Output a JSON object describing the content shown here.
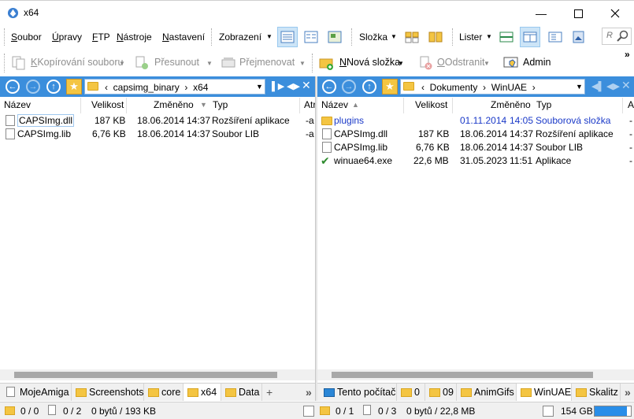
{
  "window": {
    "title": "x64"
  },
  "menu": {
    "items": [
      {
        "label": "Soubor",
        "u": "S",
        "rest": "oubor"
      },
      {
        "label": "Úpravy",
        "u": "Ú",
        "rest": "pravy"
      },
      {
        "label": "FTP",
        "u": "F",
        "rest": "TP"
      },
      {
        "label": "Nástroje",
        "u": "N",
        "rest": "ástroje"
      },
      {
        "label": "Nastavení",
        "u": "N",
        "rest": "astavení"
      }
    ],
    "view_label": "Zobrazení",
    "columns_label": "Sloupce",
    "lister_label": "Lister",
    "sort_label": "Složka",
    "search_hint": "R"
  },
  "commands": {
    "copy": "Kopírování souboru",
    "move": "Přesunout",
    "rename": "Přejmenovat",
    "new_folder": "Nová složka",
    "delete": "Odstranit",
    "admin": "Admin"
  },
  "left_panel": {
    "path": [
      "capsimg_binary",
      "x64"
    ],
    "columns": {
      "name": "Název",
      "size": "Velikost",
      "modified": "Změněno",
      "type": "Typ",
      "attr": "Atr"
    },
    "files": [
      {
        "name": "CAPSImg.dll",
        "size": "187 KB",
        "date": "18.06.2014",
        "time": "14:37",
        "type": "Rozšíření aplikace",
        "attr": "-a",
        "kind": "dll"
      },
      {
        "name": "CAPSImg.lib",
        "size": "6,76 KB",
        "date": "18.06.2014",
        "time": "14:37",
        "type": "Soubor LIB",
        "attr": "-a",
        "kind": "file"
      }
    ],
    "tabs": [
      "MojeAmiga",
      "Screenshots",
      "core",
      "x64",
      "Data"
    ],
    "active_tab": "x64",
    "status": {
      "folders": "0 / 0",
      "files": "0 / 2",
      "bytes": "0 bytů / 193 KB"
    }
  },
  "right_panel": {
    "path": [
      "Dokumenty",
      "WinUAE"
    ],
    "columns": {
      "name": "Název",
      "size": "Velikost",
      "modified": "Změněno",
      "type": "Typ",
      "attr": "A"
    },
    "files": [
      {
        "name": "plugins",
        "size": "",
        "date": "01.11.2014",
        "time": "14:05",
        "type": "Souborová složka",
        "attr": "-",
        "kind": "folder"
      },
      {
        "name": "CAPSImg.dll",
        "size": "187 KB",
        "date": "18.06.2014",
        "time": "14:37",
        "type": "Rozšíření aplikace",
        "attr": "-",
        "kind": "dll"
      },
      {
        "name": "CAPSImg.lib",
        "size": "6,76 KB",
        "date": "18.06.2014",
        "time": "14:37",
        "type": "Soubor LIB",
        "attr": "-",
        "kind": "file"
      },
      {
        "name": "winuae64.exe",
        "size": "22,6 MB",
        "date": "31.05.2023",
        "time": "11:51",
        "type": "Aplikace",
        "attr": "-",
        "kind": "exe"
      }
    ],
    "tabs": [
      "Tento počítač",
      "0",
      "09",
      "AnimGifs",
      "WinUAE",
      "Skalitz"
    ],
    "active_tab": "WinUAE",
    "status": {
      "folders": "0 / 1",
      "files": "0 / 3",
      "bytes": "0 bytů / 22,8 MB",
      "free": "154 GB"
    },
    "disk_used_fraction": 0.9
  },
  "colors": {
    "accent": "#3b8edc",
    "folder": "#f4c542",
    "link": "#1a39c8"
  }
}
